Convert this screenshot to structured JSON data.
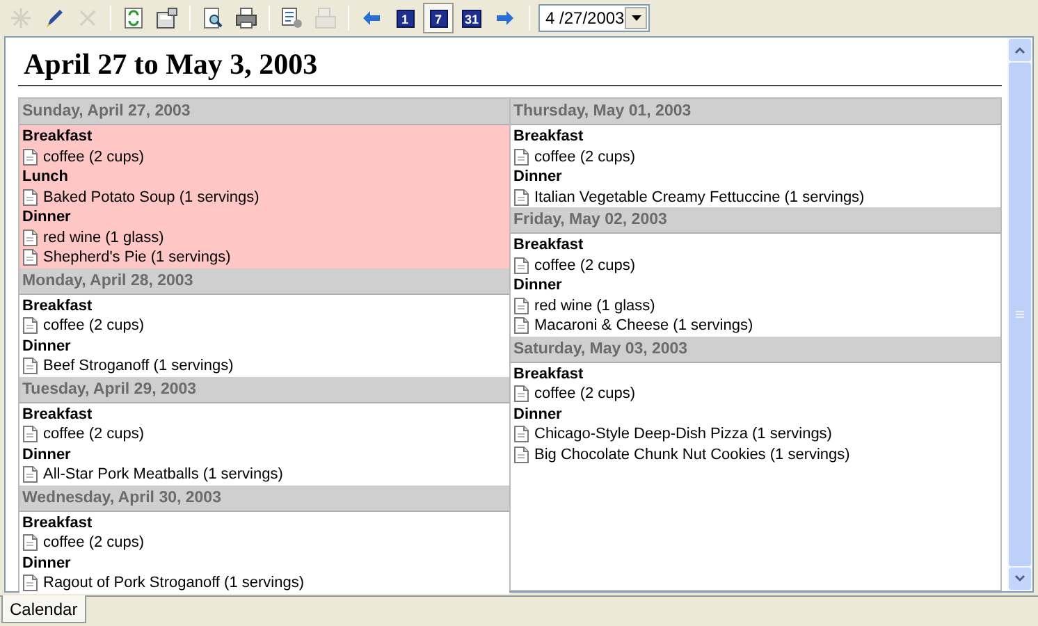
{
  "toolbar": {
    "groups": [
      [
        {
          "kind": "new",
          "disabled": true
        },
        {
          "kind": "edit",
          "disabled": false
        },
        {
          "kind": "delete",
          "disabled": true
        }
      ],
      [
        {
          "kind": "refresh",
          "disabled": false
        },
        {
          "kind": "properties",
          "disabled": false
        }
      ],
      [
        {
          "kind": "preview",
          "disabled": false
        },
        {
          "kind": "print",
          "disabled": false
        }
      ],
      [
        {
          "kind": "export",
          "disabled": false
        },
        {
          "kind": "fax",
          "disabled": true
        }
      ],
      [
        {
          "kind": "back",
          "disabled": false
        },
        {
          "kind": "view",
          "label": "1",
          "selected": false
        },
        {
          "kind": "view",
          "label": "7",
          "selected": true
        },
        {
          "kind": "view",
          "label": "31",
          "selected": false
        },
        {
          "kind": "forward",
          "disabled": false
        }
      ]
    ],
    "date_field": {
      "value": "4 /27/2003"
    }
  },
  "title": "April 27 to May 3, 2003",
  "columns": [
    {
      "days": [
        {
          "heading": "Sunday, April 27, 2003",
          "selected": true,
          "meals": [
            {
              "name": "Breakfast",
              "items": [
                "coffee (2 cups)"
              ]
            },
            {
              "name": "Lunch",
              "items": [
                "Baked Potato Soup (1 servings)"
              ]
            },
            {
              "name": "Dinner",
              "items": [
                "red wine (1 glass)",
                "Shepherd's Pie (1 servings)"
              ]
            }
          ]
        },
        {
          "heading": "Monday, April 28, 2003",
          "selected": false,
          "meals": [
            {
              "name": "Breakfast",
              "items": [
                "coffee (2 cups)"
              ]
            },
            {
              "name": "Dinner",
              "items": [
                "Beef Stroganoff (1 servings)"
              ]
            }
          ]
        },
        {
          "heading": "Tuesday, April 29, 2003",
          "selected": false,
          "meals": [
            {
              "name": "Breakfast",
              "items": [
                "coffee (2 cups)"
              ]
            },
            {
              "name": "Dinner",
              "items": [
                "All-Star Pork Meatballs (1 servings)"
              ]
            }
          ]
        },
        {
          "heading": "Wednesday, April 30, 2003",
          "selected": false,
          "meals": [
            {
              "name": "Breakfast",
              "items": [
                "coffee (2 cups)"
              ]
            },
            {
              "name": "Dinner",
              "items": [
                "Ragout of Pork Stroganoff (1 servings)"
              ]
            }
          ]
        }
      ]
    },
    {
      "days": [
        {
          "heading": "Thursday, May 01, 2003",
          "selected": false,
          "meals": [
            {
              "name": "Breakfast",
              "items": [
                "coffee (2 cups)"
              ]
            },
            {
              "name": "Dinner",
              "items": [
                "Italian Vegetable Creamy Fettuccine (1 servings)"
              ]
            }
          ]
        },
        {
          "heading": "Friday, May 02, 2003",
          "selected": false,
          "meals": [
            {
              "name": "Breakfast",
              "items": [
                "coffee (2 cups)"
              ]
            },
            {
              "name": "Dinner",
              "items": [
                "red wine (1 glass)",
                "Macaroni & Cheese (1 servings)"
              ]
            }
          ]
        },
        {
          "heading": "Saturday, May 03, 2003",
          "selected": false,
          "meals": [
            {
              "name": "Breakfast",
              "items": [
                "coffee (2 cups)"
              ]
            },
            {
              "name": "Dinner",
              "items": [
                "Chicago-Style Deep-Dish Pizza (1 servings)",
                "Big Chocolate Chunk Nut Cookies (1 servings)"
              ]
            }
          ]
        }
      ]
    }
  ],
  "tabs": [
    {
      "label": "Calendar",
      "selected": true
    }
  ]
}
